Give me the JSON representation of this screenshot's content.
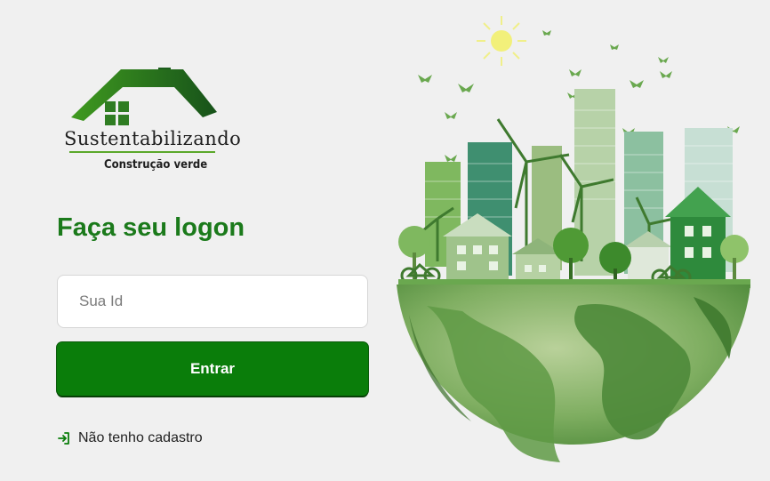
{
  "logo": {
    "brand": "Sustentabilizando",
    "tagline": "Construção verde",
    "icon": "house-icon"
  },
  "login": {
    "title": "Faça seu logon",
    "id_placeholder": "Sua Id",
    "id_value": "",
    "submit_label": "Entrar",
    "register_label": "Não tenho cadastro",
    "register_icon": "log-in-icon"
  },
  "illustration": {
    "icon": "green-city-earth-illustration"
  },
  "colors": {
    "accent": "#0a7d0a",
    "title": "#1b7a1b",
    "background": "#f0f0f0"
  }
}
